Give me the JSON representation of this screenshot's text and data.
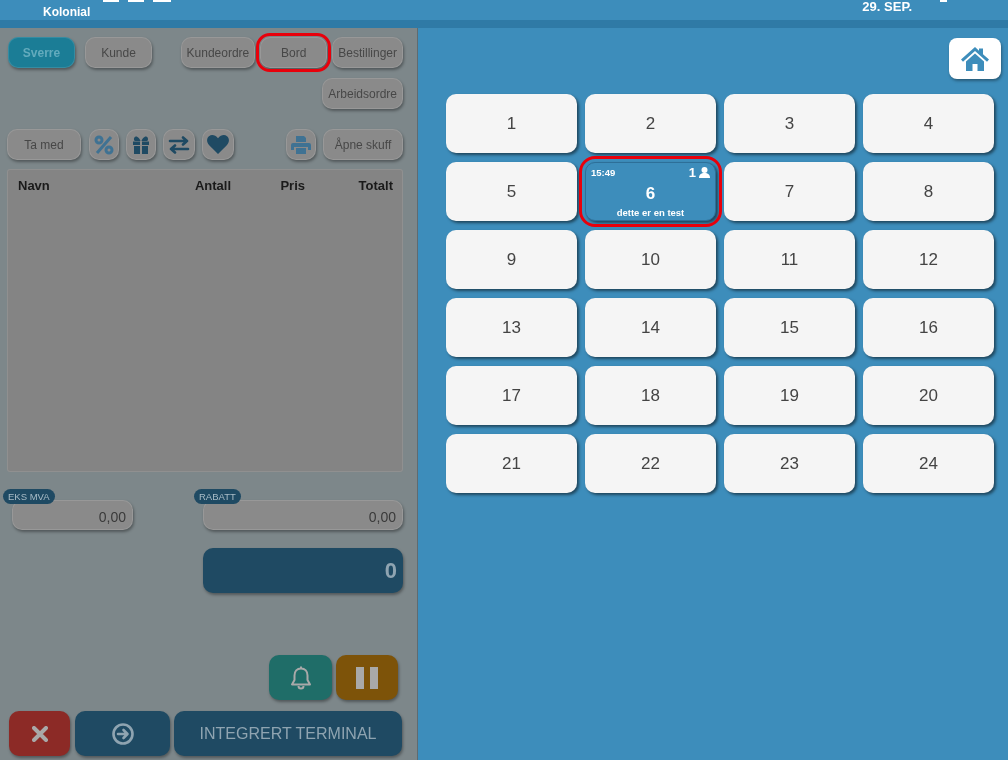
{
  "header": {
    "store_name": "Kolonial",
    "date": "29. SEP."
  },
  "order_panel": {
    "disabled": true,
    "user_buttons": [
      {
        "label": "Sverre",
        "selected": true,
        "highlighted": false
      },
      {
        "label": "Kunde",
        "selected": false,
        "highlighted": false
      }
    ],
    "view_buttons": [
      {
        "label": "Kundeordre",
        "selected": false,
        "highlighted": false
      },
      {
        "label": "Bord",
        "selected": false,
        "highlighted": true
      },
      {
        "label": "Bestillinger",
        "selected": false,
        "highlighted": false
      },
      {
        "label": "Arbeidsordre",
        "selected": false,
        "highlighted": false
      }
    ],
    "tool_buttons": {
      "take_away": "Ta med",
      "open_drawer": "Åpne skuff"
    },
    "order_table": {
      "columns": [
        "Navn",
        "Antall",
        "Pris",
        "Totalt"
      ]
    },
    "excl_vat": {
      "label": "EKS MVA",
      "value": "0,00"
    },
    "discount": {
      "label": "RABATT",
      "value": "0,00"
    },
    "total": "0",
    "terminal_button": "INTEGRERT TERMINAL"
  },
  "tables": [
    {
      "number": "1",
      "occupied": false,
      "highlighted": false
    },
    {
      "number": "2",
      "occupied": false,
      "highlighted": false
    },
    {
      "number": "3",
      "occupied": false,
      "highlighted": false
    },
    {
      "number": "4",
      "occupied": false,
      "highlighted": false
    },
    {
      "number": "5",
      "occupied": false,
      "highlighted": false
    },
    {
      "number": "6",
      "occupied": true,
      "highlighted": true,
      "time": "15:49",
      "guests": "1",
      "note": "dette er en test"
    },
    {
      "number": "7",
      "occupied": false,
      "highlighted": false
    },
    {
      "number": "8",
      "occupied": false,
      "highlighted": false
    },
    {
      "number": "9",
      "occupied": false,
      "highlighted": false
    },
    {
      "number": "10",
      "occupied": false,
      "highlighted": false
    },
    {
      "number": "11",
      "occupied": false,
      "highlighted": false
    },
    {
      "number": "12",
      "occupied": false,
      "highlighted": false
    },
    {
      "number": "13",
      "occupied": false,
      "highlighted": false
    },
    {
      "number": "14",
      "occupied": false,
      "highlighted": false
    },
    {
      "number": "15",
      "occupied": false,
      "highlighted": false
    },
    {
      "number": "16",
      "occupied": false,
      "highlighted": false
    },
    {
      "number": "17",
      "occupied": false,
      "highlighted": false
    },
    {
      "number": "18",
      "occupied": false,
      "highlighted": false
    },
    {
      "number": "19",
      "occupied": false,
      "highlighted": false
    },
    {
      "number": "20",
      "occupied": false,
      "highlighted": false
    },
    {
      "number": "21",
      "occupied": false,
      "highlighted": false
    },
    {
      "number": "22",
      "occupied": false,
      "highlighted": false
    },
    {
      "number": "23",
      "occupied": false,
      "highlighted": false
    },
    {
      "number": "24",
      "occupied": false,
      "highlighted": false
    }
  ]
}
